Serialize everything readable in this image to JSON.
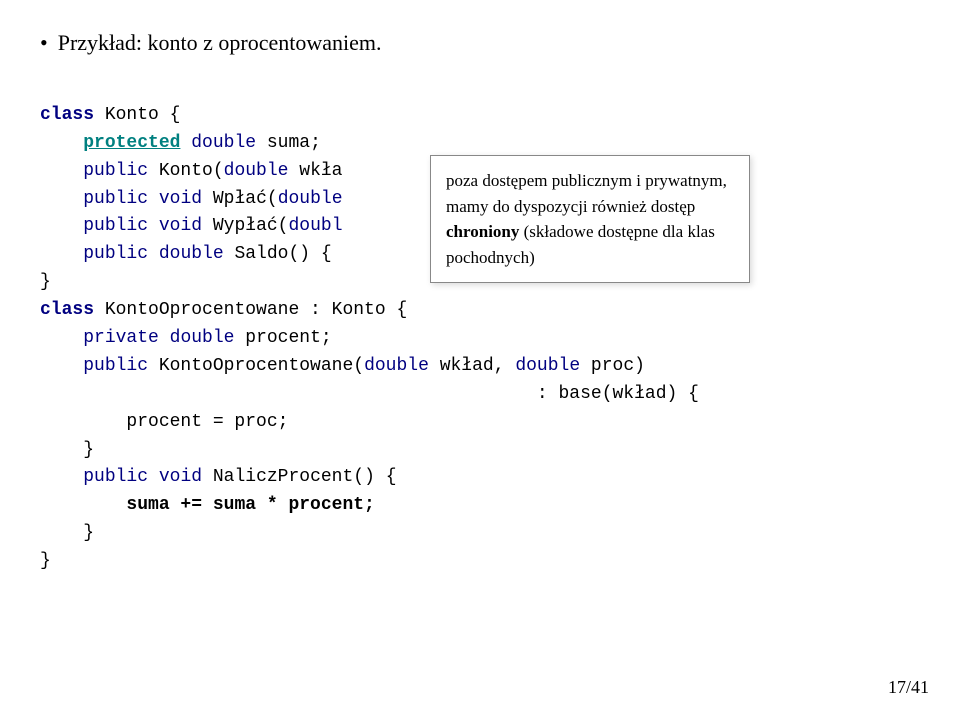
{
  "slide": {
    "bullet": {
      "text": "Przykład: konto z oprocentowaniem."
    },
    "code": {
      "lines": [
        {
          "id": "line1",
          "text": "class Konto {"
        },
        {
          "id": "line2",
          "indent": "    ",
          "protected_keyword": "protected",
          "rest": " double suma;"
        },
        {
          "id": "line3",
          "indent": "    ",
          "public_keyword": "public",
          "rest": " Konto(double wkła"
        },
        {
          "id": "line4",
          "indent": "    ",
          "public_keyword": "public",
          "void_keyword": "void",
          "rest": " Wpłać(double"
        },
        {
          "id": "line5",
          "indent": "    ",
          "public_keyword": "public",
          "void_keyword": "void",
          "rest": " Wypłać(doubl"
        },
        {
          "id": "line6",
          "indent": "    ",
          "public_keyword": "public",
          "double_keyword": "double",
          "rest": " Saldo() {"
        },
        {
          "id": "line7",
          "text": "}"
        },
        {
          "id": "line8",
          "class_keyword": "class",
          "rest": " KontoOprocentowane : Konto {"
        },
        {
          "id": "line9",
          "indent": "    ",
          "private_keyword": "private",
          "double_keyword": "double",
          "rest": " procent;"
        },
        {
          "id": "line10",
          "indent": "    ",
          "public_keyword": "public",
          "rest": " KontoOprocentowane(double wkład, double proc)"
        },
        {
          "id": "line11",
          "text": "                                              : base(wkład) {"
        },
        {
          "id": "line12",
          "text": "        procent = proc;"
        },
        {
          "id": "line13",
          "text": "    }"
        },
        {
          "id": "line14",
          "indent": "    ",
          "public_keyword": "public",
          "void_keyword": "void",
          "rest": " NaliczProcent() {"
        },
        {
          "id": "line15",
          "text": "        suma += suma * procent;",
          "bold": true
        },
        {
          "id": "line16",
          "text": "    }"
        },
        {
          "id": "line17",
          "text": "}"
        }
      ]
    },
    "tooltip": {
      "text_before": "poza dostępem publicznym i prywatnym, mamy do dyspozycji również dostęp ",
      "bold_text": "chroniony",
      "text_after": " (składowe dostępne dla klas pochodnych)"
    },
    "page_number": "17/41"
  }
}
